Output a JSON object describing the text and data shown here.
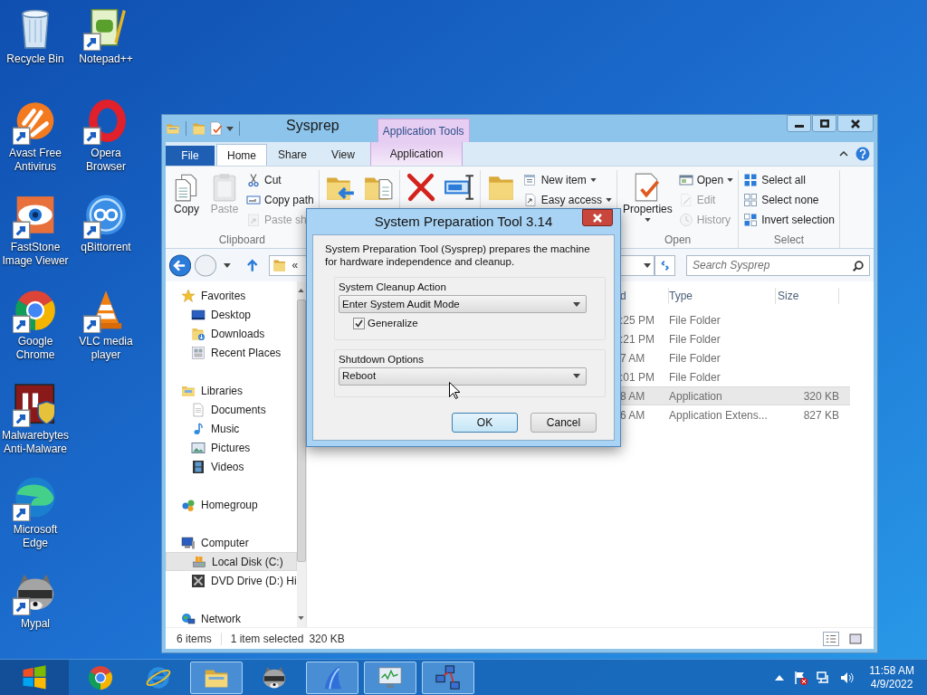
{
  "desktop": {
    "icon_rows": [
      [
        {
          "label": "Recycle Bin",
          "kind": "recycle",
          "shortcut": false
        },
        {
          "label": "Notepad++",
          "kind": "notepad",
          "shortcut": true
        }
      ],
      [
        {
          "label": "Avast Free Antivirus",
          "kind": "avast",
          "shortcut": true
        },
        {
          "label": "Opera Browser",
          "kind": "opera",
          "shortcut": true
        }
      ],
      [
        {
          "label": "FastStone Image Viewer",
          "kind": "faststone",
          "shortcut": true
        },
        {
          "label": "qBittorrent",
          "kind": "qbittorrent",
          "shortcut": true
        }
      ],
      [
        {
          "label": "Google Chrome",
          "kind": "chrome",
          "shortcut": true
        },
        {
          "label": "VLC media player",
          "kind": "vlc",
          "shortcut": true
        }
      ],
      [
        {
          "label": "Malwarebytes Anti-Malware",
          "kind": "malwarebytes",
          "shortcut": true
        }
      ],
      [
        {
          "label": "Microsoft Edge",
          "kind": "edge",
          "shortcut": true
        }
      ],
      [
        {
          "label": "Mypal",
          "kind": "mypal",
          "shortcut": true
        }
      ]
    ]
  },
  "explorer": {
    "title": "Sysprep",
    "context_group": "Application Tools",
    "tabs": [
      {
        "label": "File",
        "kind": "file",
        "selected": false
      },
      {
        "label": "Home",
        "kind": "normal",
        "selected": true
      },
      {
        "label": "Share",
        "kind": "normal",
        "selected": false
      },
      {
        "label": "View",
        "kind": "normal",
        "selected": false
      },
      {
        "label": "Application",
        "kind": "context",
        "selected": false
      }
    ],
    "ribbon_groups": [
      {
        "label": "Clipboard",
        "large": [
          {
            "label": "Copy",
            "kind": "copy",
            "disabled": false,
            "dropdown": false
          },
          {
            "label": "Paste",
            "kind": "paste",
            "disabled": true,
            "dropdown": false
          }
        ],
        "small": [
          {
            "label": "Cut",
            "kind": "cut",
            "disabled": false,
            "dropdown": false
          },
          {
            "label": "Copy path",
            "kind": "copypath",
            "disabled": false,
            "dropdown": false
          },
          {
            "label": "Paste sh",
            "kind": "pasteshortcut",
            "disabled": true,
            "dropdown": false
          }
        ]
      },
      {
        "large": [
          {
            "kind": "move",
            "disabled": false,
            "dropdown": false
          },
          {
            "kind": "copyto",
            "disabled": false,
            "dropdown": false
          }
        ]
      },
      {
        "large": [
          {
            "kind": "delete",
            "disabled": false,
            "dropdown": false
          },
          {
            "kind": "rename",
            "disabled": false,
            "dropdown": false
          }
        ]
      },
      {
        "large": [
          {
            "kind": "newfolder",
            "disabled": false,
            "dropdown": false
          }
        ],
        "small": [
          {
            "label": "New item",
            "kind": "newitem",
            "disabled": false,
            "dropdown": true
          },
          {
            "label": "Easy access",
            "kind": "easyaccess",
            "disabled": false,
            "dropdown": true
          }
        ]
      },
      {
        "label": "Open",
        "large": [
          {
            "label": "Properties",
            "kind": "properties",
            "disabled": false,
            "dropdown": true
          }
        ],
        "small": [
          {
            "label": "Open",
            "kind": "open",
            "disabled": false,
            "dropdown": true
          },
          {
            "label": "Edit",
            "kind": "edit",
            "disabled": true,
            "dropdown": false
          },
          {
            "label": "History",
            "kind": "history",
            "disabled": true,
            "dropdown": false
          }
        ]
      },
      {
        "label": "Select",
        "small": [
          {
            "label": "Select all",
            "kind": "selectall",
            "disabled": false,
            "dropdown": false
          },
          {
            "label": "Select none",
            "kind": "selectnone",
            "disabled": false,
            "dropdown": false
          },
          {
            "label": "Invert selection",
            "kind": "invert",
            "disabled": false,
            "dropdown": false
          }
        ]
      }
    ],
    "address": {
      "chevron": "«"
    },
    "search": {
      "placeholder": "Search Sysprep"
    },
    "nav_tree": [
      {
        "label": "Favorites",
        "kind": "star",
        "selected": false,
        "children": [
          {
            "label": "Desktop",
            "kind": "desktop",
            "selected": false
          },
          {
            "label": "Downloads",
            "kind": "downloads",
            "selected": false
          },
          {
            "label": "Recent Places",
            "kind": "recent",
            "selected": false
          }
        ]
      },
      {
        "label": "Libraries",
        "kind": "libraries",
        "selected": false,
        "children": [
          {
            "label": "Documents",
            "kind": "documents",
            "selected": false
          },
          {
            "label": "Music",
            "kind": "music",
            "selected": false
          },
          {
            "label": "Pictures",
            "kind": "pictures",
            "selected": false
          },
          {
            "label": "Videos",
            "kind": "videos",
            "selected": false
          }
        ]
      },
      {
        "label": "Homegroup",
        "kind": "homegroup",
        "selected": false
      },
      {
        "label": "Computer",
        "kind": "computer",
        "selected": false,
        "children": [
          {
            "label": "Local Disk (C:)",
            "kind": "disk",
            "selected": true
          },
          {
            "label": "DVD Drive (D:) Hi",
            "kind": "dvd",
            "selected": false
          }
        ]
      },
      {
        "label": "Network",
        "kind": "network",
        "selected": false
      }
    ],
    "file_list": {
      "columns": [
        "d",
        "Type",
        "Size"
      ],
      "rows": [
        {
          "date": ":25 PM",
          "type": "File Folder",
          "size": "",
          "selected": false
        },
        {
          "date": ":21 PM",
          "type": "File Folder",
          "size": "",
          "selected": false
        },
        {
          "date": "7 AM",
          "type": "File Folder",
          "size": "",
          "selected": false
        },
        {
          "date": ":01 PM",
          "type": "File Folder",
          "size": "",
          "selected": false
        },
        {
          "date": "8 AM",
          "type": "Application",
          "size": "320 KB",
          "selected": true
        },
        {
          "date": "6 AM",
          "type": "Application Extens...",
          "size": "827 KB",
          "selected": false
        }
      ]
    },
    "status_bar": {
      "count": "6 items",
      "selection": "1 item selected",
      "selection_size": "320 KB"
    }
  },
  "dialog": {
    "title": "System Preparation Tool 3.14",
    "description": "System Preparation Tool (Sysprep) prepares the machine for hardware independence and cleanup.",
    "cleanup": {
      "label": "System Cleanup Action",
      "value": "Enter System Audit Mode",
      "generalize": {
        "label": "Generalize",
        "checked": true
      }
    },
    "shutdown": {
      "label": "Shutdown Options",
      "value": "Reboot"
    },
    "buttons": [
      {
        "label": "OK",
        "default": true
      },
      {
        "label": "Cancel",
        "default": false
      }
    ]
  },
  "taskbar": {
    "items": [
      {
        "kind": "chrome",
        "running": false
      },
      {
        "kind": "ie",
        "running": false
      },
      {
        "kind": "explorer",
        "running": true
      },
      {
        "kind": "mypal",
        "running": false
      },
      {
        "kind": "sharp",
        "running": true
      },
      {
        "kind": "monitor",
        "running": true
      },
      {
        "kind": "network",
        "running": true
      }
    ],
    "time": "11:58 AM",
    "date": "4/9/2022"
  }
}
